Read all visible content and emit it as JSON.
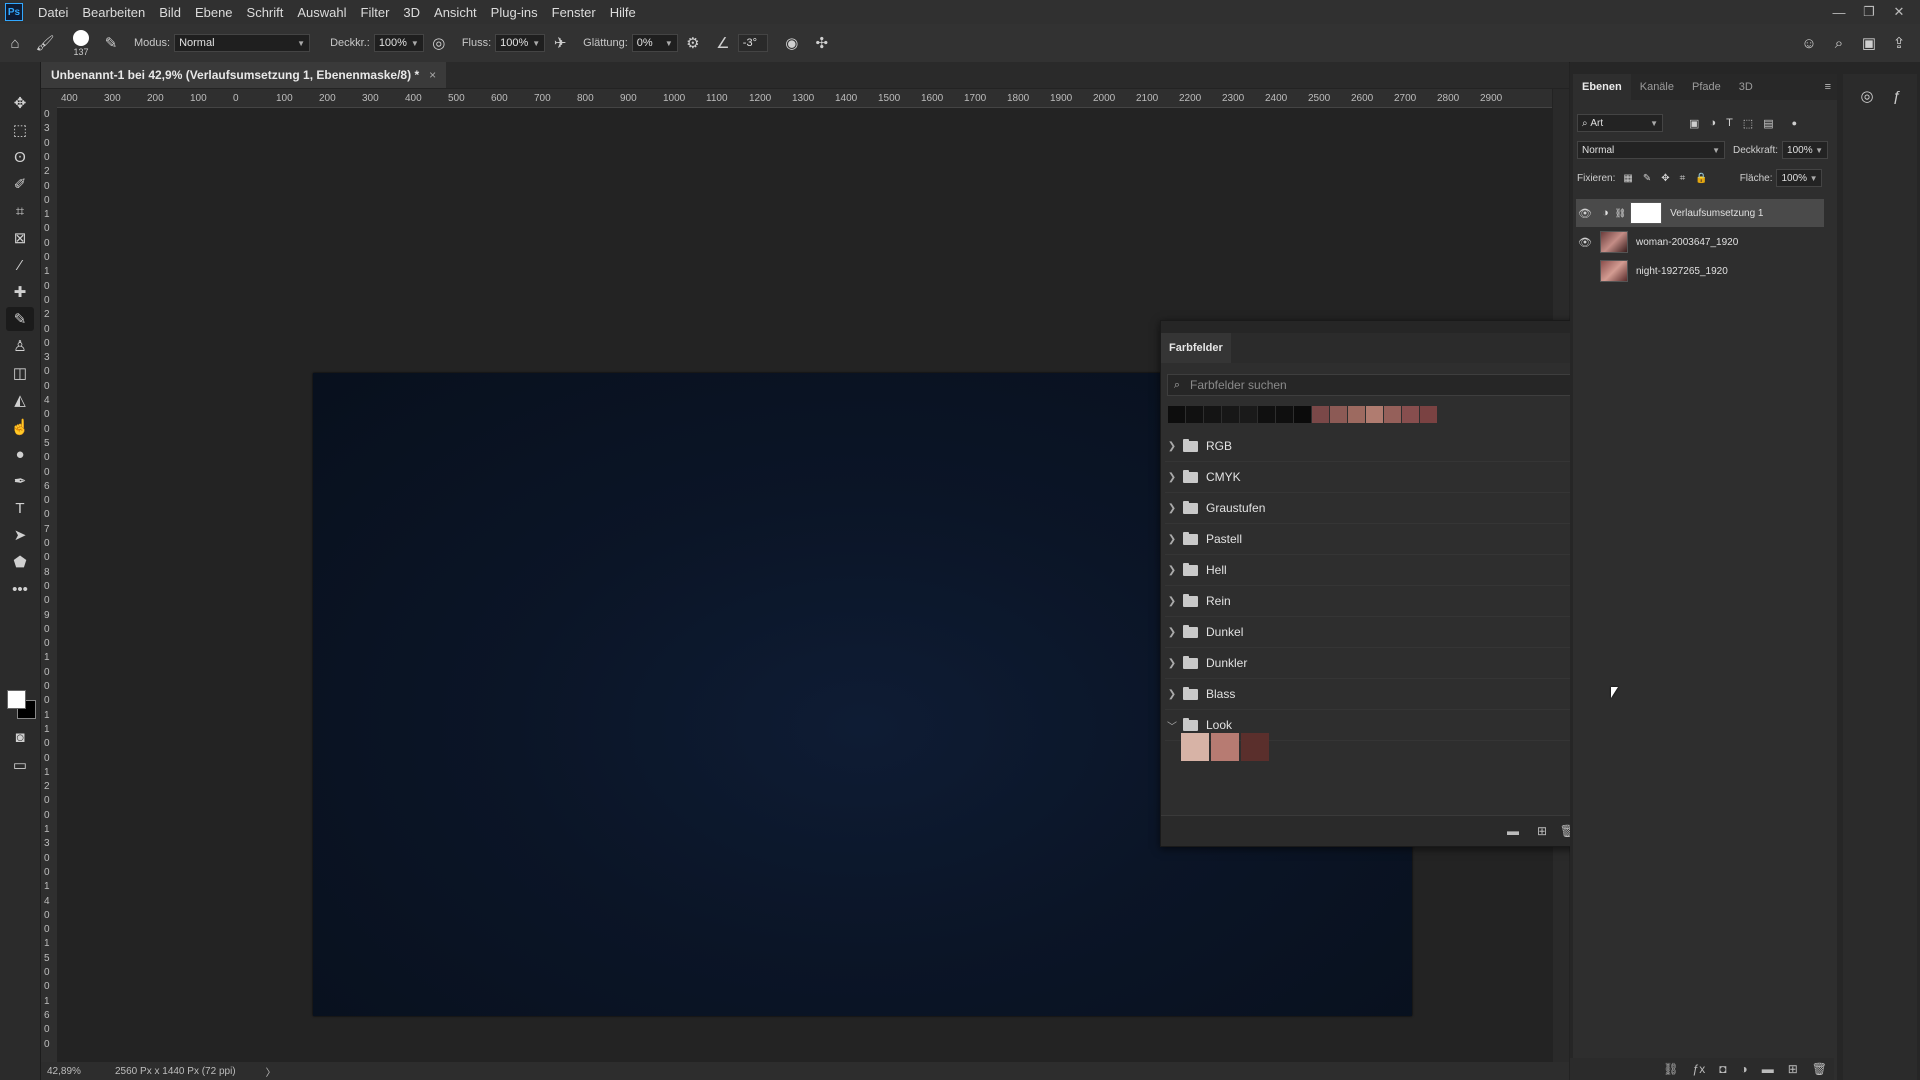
{
  "app": {
    "logo": "Ps"
  },
  "menu": [
    "Datei",
    "Bearbeiten",
    "Bild",
    "Ebene",
    "Schrift",
    "Auswahl",
    "Filter",
    "3D",
    "Ansicht",
    "Plug-ins",
    "Fenster",
    "Hilfe"
  ],
  "window_controls": {
    "minimize": "—",
    "restore": "❐",
    "close": "✕"
  },
  "options": {
    "brush_size": "137",
    "mode_label": "Modus:",
    "mode_value": "Normal",
    "opacity_label": "Deckkr.:",
    "opacity_value": "100%",
    "flow_label": "Fluss:",
    "flow_value": "100%",
    "smoothing_label": "Glättung:",
    "smoothing_value": "0%",
    "angle_value": "-3°"
  },
  "document": {
    "tab_title": "Unbenannt-1 bei 42,9% (Verlaufsumsetzung 1, Ebenenmaske/8) *",
    "close": "×",
    "canvas_color": "#0b1527"
  },
  "ruler_top": [
    "400",
    "300",
    "200",
    "100",
    "0",
    "100",
    "200",
    "300",
    "400",
    "500",
    "600",
    "700",
    "800",
    "900",
    "1000",
    "1100",
    "1200",
    "1300",
    "1400",
    "1500",
    "1600",
    "1700",
    "1800",
    "1900",
    "2000",
    "2100",
    "2200",
    "2300",
    "2400",
    "2500",
    "2600",
    "2700",
    "2800",
    "2900"
  ],
  "ruler_left": [
    "0",
    "3",
    "0",
    "0",
    "2",
    "0",
    "0",
    "1",
    "0",
    "0",
    "0",
    "1",
    "0",
    "0",
    "2",
    "0",
    "0",
    "3",
    "0",
    "0",
    "4",
    "0",
    "0",
    "5",
    "0",
    "0",
    "6",
    "0",
    "0",
    "7",
    "0",
    "0",
    "8",
    "0",
    "0",
    "9",
    "0",
    "0",
    "1",
    "0",
    "0",
    "0",
    "1",
    "1",
    "0",
    "0",
    "1",
    "2",
    "0",
    "0",
    "1",
    "3",
    "0",
    "0",
    "1",
    "4",
    "0",
    "0",
    "1",
    "5",
    "0",
    "0",
    "1",
    "6",
    "0",
    "0"
  ],
  "status": {
    "zoom": "42,89%",
    "size": "2560 Px x 1440 Px (72 ppi)",
    "arrow": "〉"
  },
  "swatches": {
    "title": "Farbfelder",
    "search_placeholder": "Farbfelder suchen",
    "recent": [
      "#0d0d0d",
      "#111111",
      "#141414",
      "#171717",
      "#1a1a1a",
      "#101010",
      "#0f0f0f",
      "#0b0b0b",
      "#7a4848",
      "#8c5a55",
      "#9d6a60",
      "#b07c70",
      "#95605a",
      "#874e4e",
      "#7a4242"
    ],
    "groups": [
      "RGB",
      "CMYK",
      "Graustufen",
      "Pastell",
      "Hell",
      "Rein",
      "Dunkel",
      "Dunkler",
      "Blass",
      "Look"
    ],
    "look": [
      "#d7b3a6",
      "#b77b72",
      "#5a2f2c"
    ]
  },
  "layers": {
    "tabs": [
      "Ebenen",
      "Kanäle",
      "Pfade",
      "3D"
    ],
    "filter_label": "Art",
    "blend_mode": "Normal",
    "opacity_label": "Deckkraft:",
    "opacity_value": "100%",
    "lock_label": "Fixieren:",
    "fill_label": "Fläche:",
    "fill_value": "100%",
    "items": [
      {
        "name": "Verlaufsumsetzung 1"
      },
      {
        "name": "woman-2003647_1920"
      },
      {
        "name": "night-1927265_1920"
      }
    ]
  }
}
